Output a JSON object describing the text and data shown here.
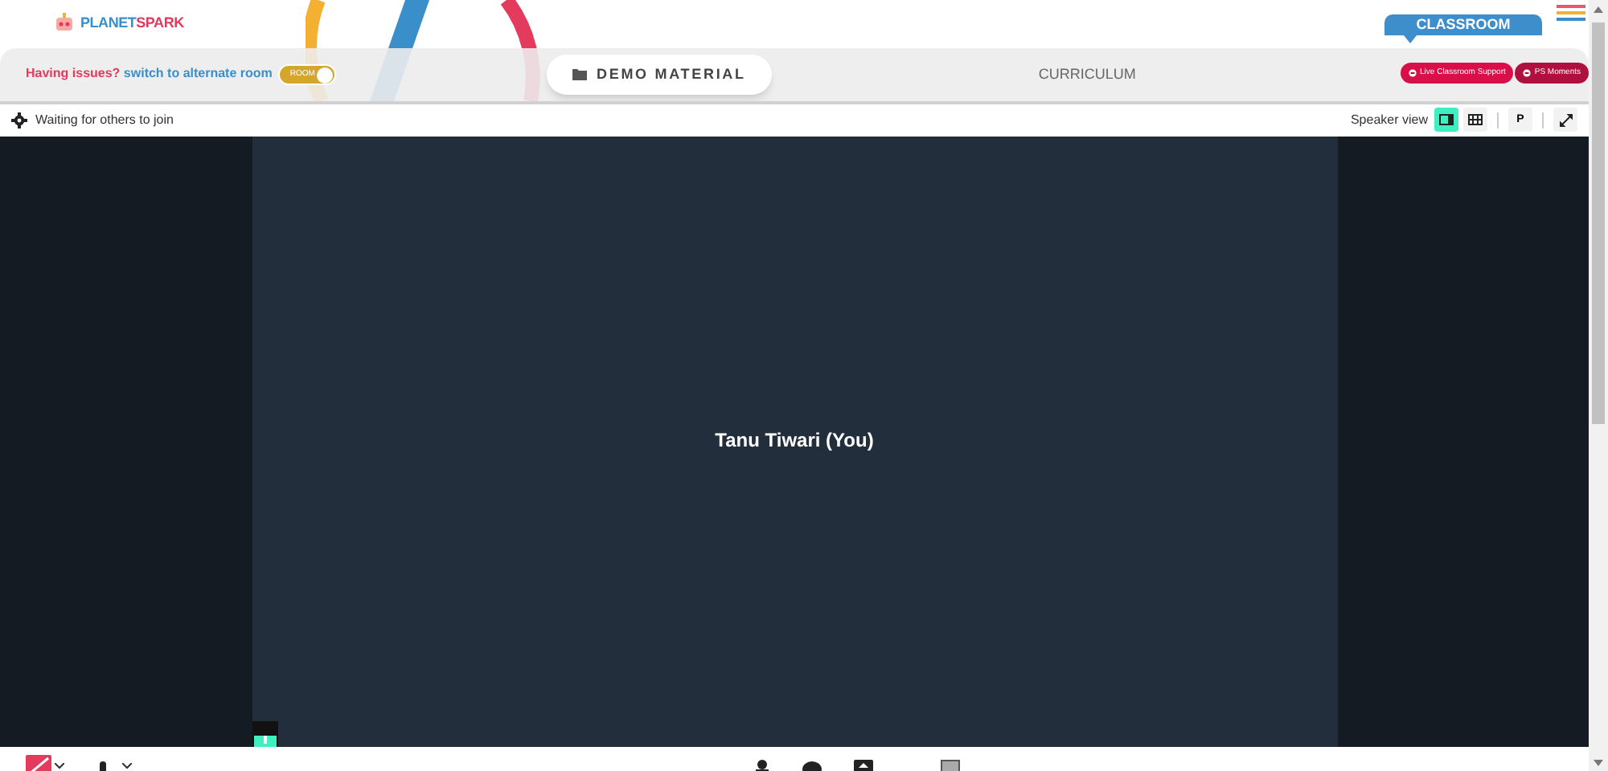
{
  "logo": {
    "parts": [
      "PLANET",
      "SPARK"
    ]
  },
  "menu": {
    "open": false
  },
  "notice": {
    "question": "Having issues?",
    "link": "switch to alternate room",
    "toggle_label": "ROOM",
    "toggle_on": true
  },
  "tabs": [
    {
      "label": "DEMO MATERIAL",
      "selected": true
    },
    {
      "label": "CURRICULUM",
      "selected": false
    }
  ],
  "classroom_tab": {
    "label": "CLASSROOM"
  },
  "support_buttons": [
    "Live Classroom Support",
    "PS Moments"
  ],
  "toolbar": {
    "status": "Waiting for others to join",
    "view_label": "Speaker view",
    "views": [
      {
        "kind": "speaker",
        "selected": true
      },
      {
        "kind": "grid",
        "selected": false
      }
    ],
    "pin_label": "P"
  },
  "video": {
    "participant": "Tanu Tiwari (You)",
    "mic_active": true
  },
  "bottom_bar": {
    "camera_off": true
  }
}
